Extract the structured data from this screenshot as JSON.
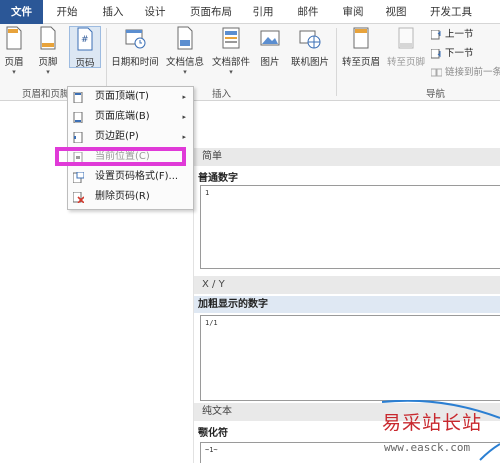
{
  "tabs": [
    {
      "label": "文件"
    },
    {
      "label": "开始"
    },
    {
      "label": "插入"
    },
    {
      "label": "设计"
    },
    {
      "label": "页面布局"
    },
    {
      "label": "引用"
    },
    {
      "label": "邮件"
    },
    {
      "label": "审阅"
    },
    {
      "label": "视图"
    },
    {
      "label": "开发工具"
    }
  ],
  "ribbon": {
    "buttons": [
      {
        "label": "页眉",
        "icon": "header-icon"
      },
      {
        "label": "页脚",
        "icon": "footer-icon"
      },
      {
        "label": "页码",
        "icon": "page-number-icon"
      },
      {
        "label": "日期和时间",
        "icon": "date-time-icon"
      },
      {
        "label": "文档信息",
        "icon": "document-info-icon"
      },
      {
        "label": "文档部件",
        "icon": "quick-parts-icon"
      },
      {
        "label": "图片",
        "icon": "picture-icon"
      },
      {
        "label": "联机图片",
        "icon": "online-picture-icon"
      },
      {
        "label": "转至页眉",
        "icon": "goto-header-icon"
      },
      {
        "label": "转至页脚",
        "icon": "goto-footer-icon"
      }
    ],
    "nav": {
      "prev": "上一节",
      "next": "下一节",
      "link": "链接到前一条"
    },
    "groups": {
      "header_footer": "页眉和页脚",
      "insert": "插入",
      "navigation": "导航"
    }
  },
  "menu": {
    "items": [
      {
        "label": "页面顶端(T)",
        "icon": "page-top-icon",
        "submenu": "▸"
      },
      {
        "label": "页面底端(B)",
        "icon": "page-bottom-icon",
        "submenu": "▸"
      },
      {
        "label": "页边距(P)",
        "icon": "page-margin-icon",
        "submenu": "▸"
      },
      {
        "label": "当前位置(C)",
        "icon": "current-position-icon",
        "submenu": "▸"
      },
      {
        "label": "设置页码格式(F)...",
        "icon": "format-page-number-icon",
        "submenu": ""
      },
      {
        "label": "删除页码(R)",
        "icon": "remove-page-number-icon",
        "submenu": ""
      }
    ]
  },
  "gallery": {
    "sections": [
      {
        "header": "简单",
        "item": "普通数字",
        "preview": "1"
      },
      {
        "header": "X / Y",
        "item": "加粗显示的数字",
        "preview": "1/1"
      },
      {
        "header": "纯文本",
        "item": "颚化符",
        "preview": "~1~"
      }
    ]
  },
  "watermark": {
    "title": "易采站长站",
    "url": "www.easck.com"
  },
  "colors": {
    "file_tab": "#2b5797",
    "highlight_box": "#e03ad8",
    "watermark": "#c8282e"
  }
}
